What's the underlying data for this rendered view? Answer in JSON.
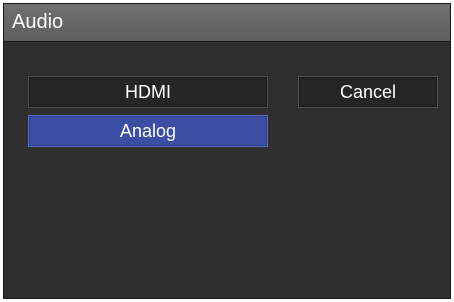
{
  "dialog": {
    "title": "Audio",
    "options": [
      {
        "label": "HDMI",
        "selected": false
      },
      {
        "label": "Analog",
        "selected": true
      }
    ],
    "cancel_label": "Cancel"
  },
  "colors": {
    "selected": "#3c4ea3",
    "background": "#2f2f2f",
    "titlebar": "#666666"
  }
}
